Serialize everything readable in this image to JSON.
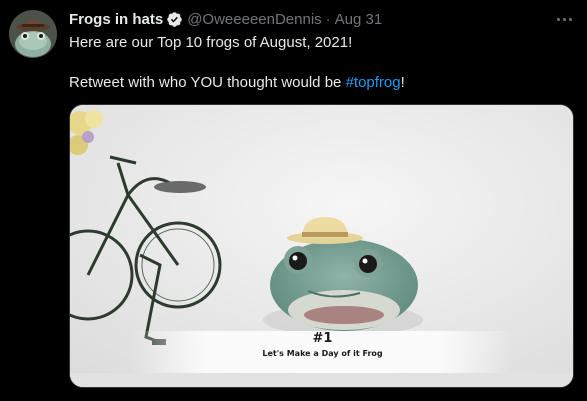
{
  "tweet": {
    "display_name": "Frogs in hats",
    "handle": "@OweeeeenDennis",
    "separator": "·",
    "timestamp": "Aug 31",
    "text_line1": "Here are our Top 10 frogs of August, 2021!",
    "text_line2_prefix": "Retweet with who YOU thought would be ",
    "hashtag": "#topfrog",
    "text_line2_suffix": "!"
  },
  "media": {
    "caption_rank": "#1",
    "caption_title": "Let's Make a Day of it Frog"
  },
  "colors": {
    "background": "#000000",
    "primary_text": "#e7e9ea",
    "secondary_text": "#71767b",
    "link": "#1d9bf0"
  },
  "icons": {
    "verified": "verified-badge-icon",
    "more": "more-dots-icon"
  }
}
